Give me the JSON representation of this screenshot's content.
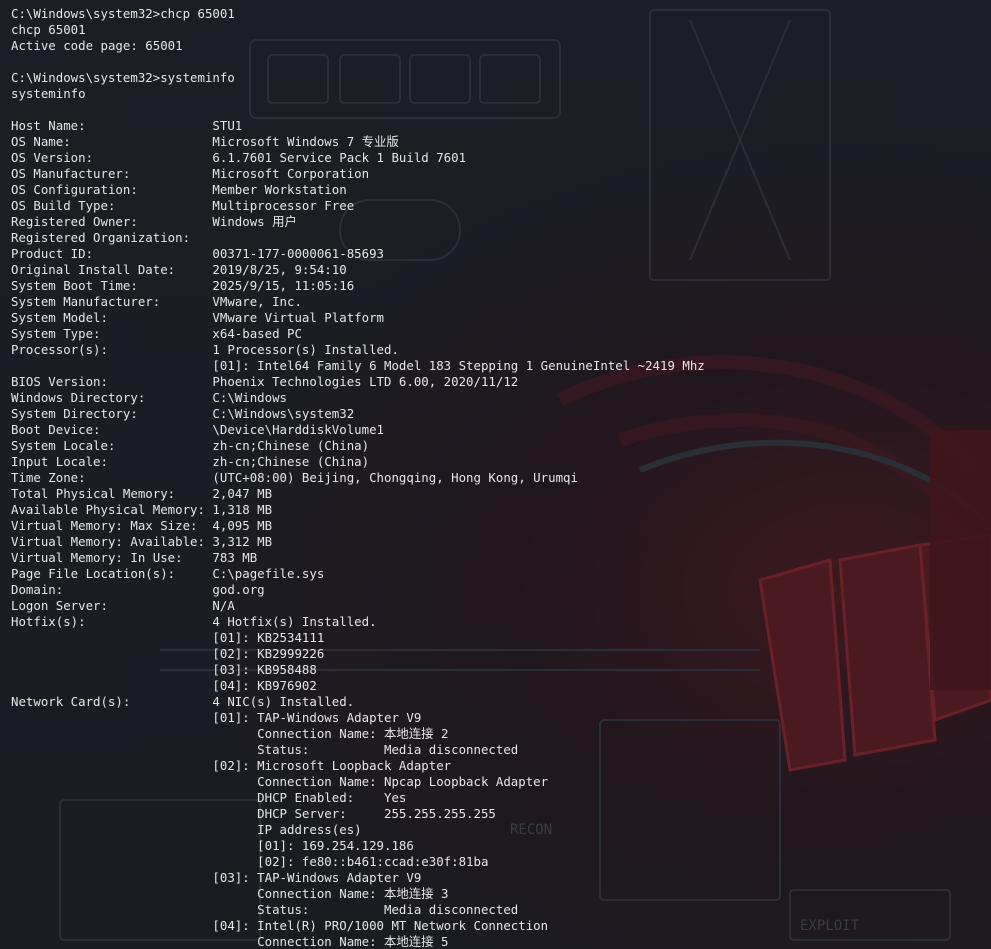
{
  "terminal": {
    "lines": [
      "C:\\Windows\\system32>chcp 65001",
      "chcp 65001",
      "Active code page: 65001",
      "",
      "C:\\Windows\\system32>systeminfo",
      "systeminfo",
      "",
      "Host Name:                 STU1",
      "OS Name:                   Microsoft Windows 7 专业版",
      "OS Version:                6.1.7601 Service Pack 1 Build 7601",
      "OS Manufacturer:           Microsoft Corporation",
      "OS Configuration:          Member Workstation",
      "OS Build Type:             Multiprocessor Free",
      "Registered Owner:          Windows 用户",
      "Registered Organization:",
      "Product ID:                00371-177-0000061-85693",
      "Original Install Date:     2019/8/25, 9:54:10",
      "System Boot Time:          2025/9/15, 11:05:16",
      "System Manufacturer:       VMware, Inc.",
      "System Model:              VMware Virtual Platform",
      "System Type:               x64-based PC",
      "Processor(s):              1 Processor(s) Installed.",
      "                           [01]: Intel64 Family 6 Model 183 Stepping 1 GenuineIntel ~2419 Mhz",
      "BIOS Version:              Phoenix Technologies LTD 6.00, 2020/11/12",
      "Windows Directory:         C:\\Windows",
      "System Directory:          C:\\Windows\\system32",
      "Boot Device:               \\Device\\HarddiskVolume1",
      "System Locale:             zh-cn;Chinese (China)",
      "Input Locale:              zh-cn;Chinese (China)",
      "Time Zone:                 (UTC+08:00) Beijing, Chongqing, Hong Kong, Urumqi",
      "Total Physical Memory:     2,047 MB",
      "Available Physical Memory: 1,318 MB",
      "Virtual Memory: Max Size:  4,095 MB",
      "Virtual Memory: Available: 3,312 MB",
      "Virtual Memory: In Use:    783 MB",
      "Page File Location(s):     C:\\pagefile.sys",
      "Domain:                    god.org",
      "Logon Server:              N/A",
      "Hotfix(s):                 4 Hotfix(s) Installed.",
      "                           [01]: KB2534111",
      "                           [02]: KB2999226",
      "                           [03]: KB958488",
      "                           [04]: KB976902",
      "Network Card(s):           4 NIC(s) Installed.",
      "                           [01]: TAP-Windows Adapter V9",
      "                                 Connection Name: 本地连接 2",
      "                                 Status:          Media disconnected",
      "                           [02]: Microsoft Loopback Adapter",
      "                                 Connection Name: Npcap Loopback Adapter",
      "                                 DHCP Enabled:    Yes",
      "                                 DHCP Server:     255.255.255.255",
      "                                 IP address(es)",
      "                                 [01]: 169.254.129.186",
      "                                 [02]: fe80::b461:ccad:e30f:81ba",
      "                           [03]: TAP-Windows Adapter V9",
      "                                 Connection Name: 本地连接 3",
      "                                 Status:          Media disconnected",
      "                           [04]: Intel(R) PRO/1000 MT Network Connection",
      "                                 Connection Name: 本地连接 5"
    ]
  },
  "wallpaper": {
    "labels": [
      "RECON",
      "EXPLOIT"
    ],
    "accent_color": "#5a1a22",
    "ascii_color": "#3a3d46"
  }
}
